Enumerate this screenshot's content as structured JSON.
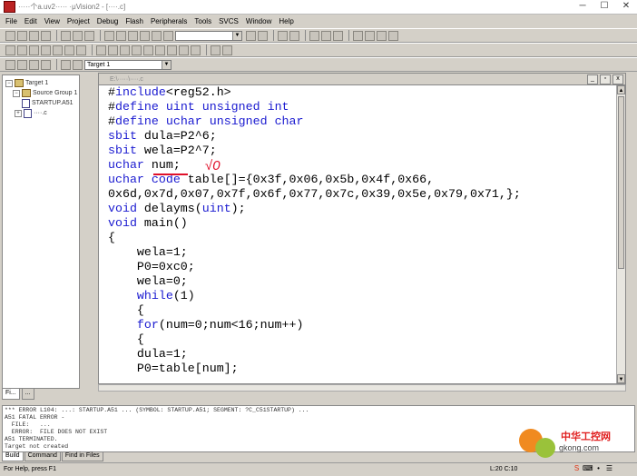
{
  "window": {
    "title": "·····个a.uv2····· ·μVision2 - [····.c]"
  },
  "menu": [
    "File",
    "Edit",
    "View",
    "Project",
    "Debug",
    "Flash",
    "Peripherals",
    "Tools",
    "SVCS",
    "Window",
    "Help"
  ],
  "toolbar3": {
    "target": "Target 1"
  },
  "project": {
    "tree": [
      "Target 1",
      "Source Group 1",
      "STARTUP.A51",
      "····.c"
    ],
    "tabs": [
      "Fi...",
      "..."
    ]
  },
  "editor": {
    "title": "E:\\·····\\····.c",
    "code": [
      "#include<reg52.h>",
      "#define uint unsigned int",
      "#define uchar unsigned char",
      "sbit dula=P2^6;",
      "sbit wela=P2^7;",
      "uchar num;",
      "uchar code table[]={0x3f,0x06,0x5b,0x4f,0x66,",
      "0x6d,0x7d,0x07,0x7f,0x6f,0x77,0x7c,0x39,0x5e,0x79,0x71,};",
      "void delayms(uint);",
      "void main()",
      "{",
      "    wela=1;",
      "    P0=0xc0;",
      "    wela=0;",
      "    while(1)",
      "    {",
      "    for(num=0;num<16;num++)",
      "    {",
      "    dula=1;",
      "    P0=table[num];"
    ],
    "annotation": "√0"
  },
  "output": {
    "lines": [
      "*** ERROR L104: ...: STARTUP.A51 ... (SYMBOL: STARTUP.A51; SEGMENT: ?C_C51STARTUP) ...",
      "A51 FATAL ERROR -",
      "  FILE:   ...",
      "  ERROR:  FILE DOES NOT EXIST",
      "A51 TERMINATED.",
      "Target not created"
    ],
    "tabs": [
      "Build",
      "Command",
      "Find in Files"
    ]
  },
  "status": {
    "help": "For Help, press F1",
    "position": "L:20 C:10"
  },
  "watermark": {
    "brand": "中华工控网",
    "domain": "gkong.com"
  }
}
